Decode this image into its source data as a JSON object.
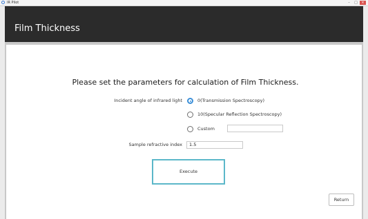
{
  "window": {
    "title": "IR Pilot"
  },
  "header": {
    "title": "Film Thickness"
  },
  "main": {
    "heading": "Please set the parameters for calculation of Film Thickness.",
    "incident_label": "Incident angle of infrared light",
    "options": [
      {
        "label": "0(Transmission Spectroscopy)",
        "selected": true
      },
      {
        "label": "10(Specular Reflection Spectroscopy)",
        "selected": false
      },
      {
        "label": "Custom",
        "selected": false
      }
    ],
    "custom_value": "",
    "refractive_label": "Sample refractive index",
    "refractive_value": "1.5",
    "execute_label": "Execute",
    "return_label": "Return"
  }
}
